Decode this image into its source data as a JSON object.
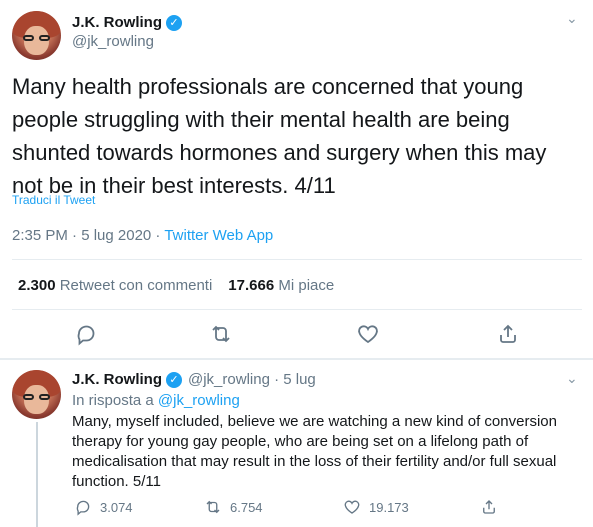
{
  "main_tweet": {
    "name": "J.K. Rowling",
    "handle": "@jk_rowling",
    "body": "Many health professionals are concerned that young people struggling with their mental health are being shunted towards hormones and surgery when this may not be in their best interests. 4/11",
    "translate_label": "Traduci il Tweet",
    "time": "2:35 PM · 5 lug 2020 · ",
    "app": "Twitter Web App",
    "retweets_count": "2.300",
    "retweets_label": "Retweet con commenti",
    "likes_count": "17.666",
    "likes_label": "Mi piace"
  },
  "reply_tweet": {
    "name": "J.K. Rowling",
    "handle": "@jk_rowling · 5 lug",
    "reply_prefix": "In risposta a ",
    "reply_target": "@jk_rowling",
    "body": "Many, myself included, believe we are watching a new kind of conversion therapy for young gay people, who are being set on a lifelong path of medicalisation that may result in the loss of their fertility and/or full sexual function. 5/11",
    "replies": "3.074",
    "retweets": "6.754",
    "likes": "19.173"
  },
  "icons": {
    "verified": "verified-badge-icon",
    "chevron": "chevron-down-icon",
    "reply": "reply-icon",
    "retweet": "retweet-icon",
    "like": "heart-icon",
    "share": "share-icon"
  },
  "colors": {
    "accent": "#1da1f2",
    "secondary_text": "#657786",
    "primary_text": "#14171a",
    "divider": "#e6ecf0"
  }
}
